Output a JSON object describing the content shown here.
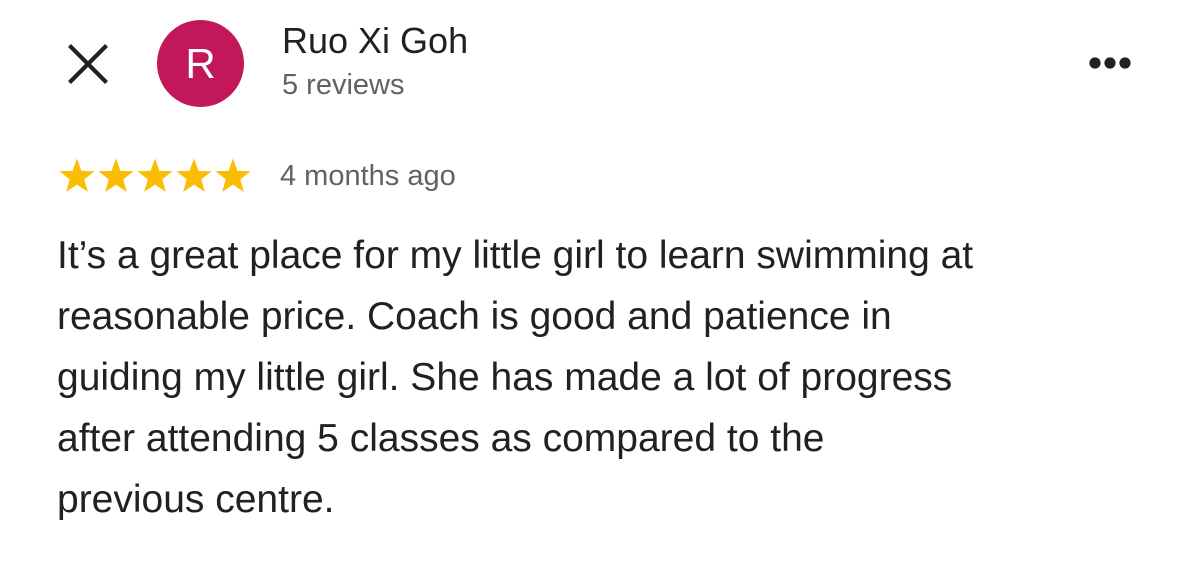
{
  "reviewer": {
    "initial": "R",
    "name": "Ruo Xi Goh",
    "review_count": "5 reviews",
    "avatar_color": "#c2185b"
  },
  "header": {
    "close_icon": "close-icon",
    "more_icon": "more-horizontal-icon"
  },
  "review": {
    "rating": 5,
    "max_rating": 5,
    "star_color": "#fbbc04",
    "time": "4 months ago",
    "lines": [
      "It’s a great place for my little girl to learn swimming at",
      "reasonable price. Coach is good and patience in",
      "guiding my little girl. She has made a lot of progress",
      "after attending 5 classes as compared to the",
      "previous centre."
    ]
  }
}
